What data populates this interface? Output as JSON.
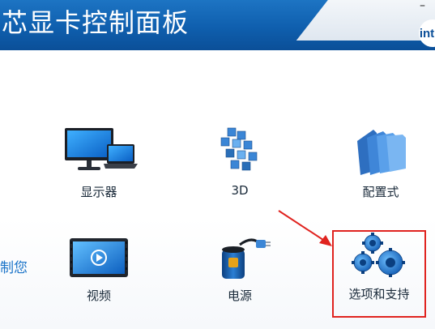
{
  "header": {
    "title": "芯显卡控制面板",
    "minimize_glyph": "–",
    "logo_text": "int"
  },
  "tiles": [
    {
      "label": "显示器",
      "icon": "monitor-laptop-icon"
    },
    {
      "label": "3D",
      "icon": "3d-cubes-icon"
    },
    {
      "label": "配置式",
      "icon": "folders-icon"
    },
    {
      "label": "视频",
      "icon": "video-player-icon"
    },
    {
      "label": "电源",
      "icon": "power-battery-icon"
    },
    {
      "label": "选项和支持",
      "icon": "gears-icon"
    }
  ],
  "left_partial_text": "制您",
  "colors": {
    "header_blue": "#1566b5",
    "highlight_red": "#e0231f",
    "link_blue": "#1a73c8"
  }
}
